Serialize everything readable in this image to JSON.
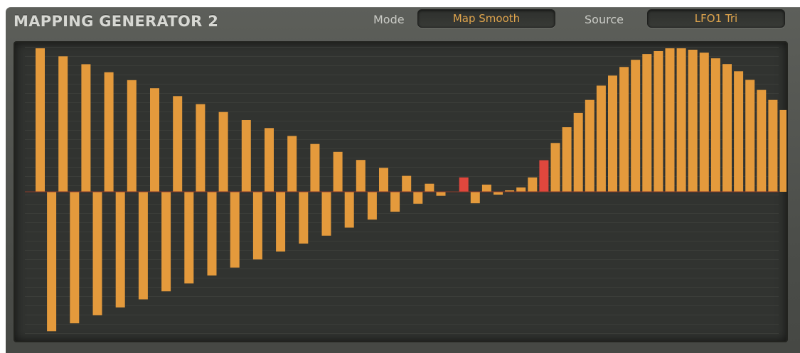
{
  "header": {
    "title": "MAPPING GENERATOR 2",
    "mode_label": "Mode",
    "mode_value": "Map Smooth",
    "source_label": "Source",
    "source_value": "LFO1 Tri"
  },
  "colors": {
    "bar": "#e49a3c",
    "bar_highlight": "#e0473d",
    "accent_text": "#e0a54d",
    "zero_line": "#8c3b2a"
  },
  "steps": {
    "highlighted_indices": [
      37,
      44
    ],
    "values": [
      1.0,
      -0.972,
      0.944,
      -0.917,
      0.889,
      -0.861,
      0.833,
      -0.806,
      0.778,
      -0.75,
      0.722,
      -0.694,
      0.667,
      -0.639,
      0.611,
      -0.583,
      0.556,
      -0.528,
      0.5,
      -0.472,
      0.444,
      -0.417,
      0.389,
      -0.361,
      0.333,
      -0.306,
      0.278,
      -0.25,
      0.222,
      -0.194,
      0.167,
      -0.139,
      0.111,
      -0.083,
      0.056,
      -0.028,
      0.0,
      0.1,
      -0.08,
      0.05,
      -0.02,
      0.01,
      0.03,
      0.1,
      0.22,
      0.34,
      0.45,
      0.55,
      0.64,
      0.74,
      0.81,
      0.87,
      0.92,
      0.96,
      0.98,
      1.0,
      1.0,
      0.99,
      0.97,
      0.93,
      0.89,
      0.84,
      0.78,
      0.71,
      0.64,
      0.57
    ]
  }
}
